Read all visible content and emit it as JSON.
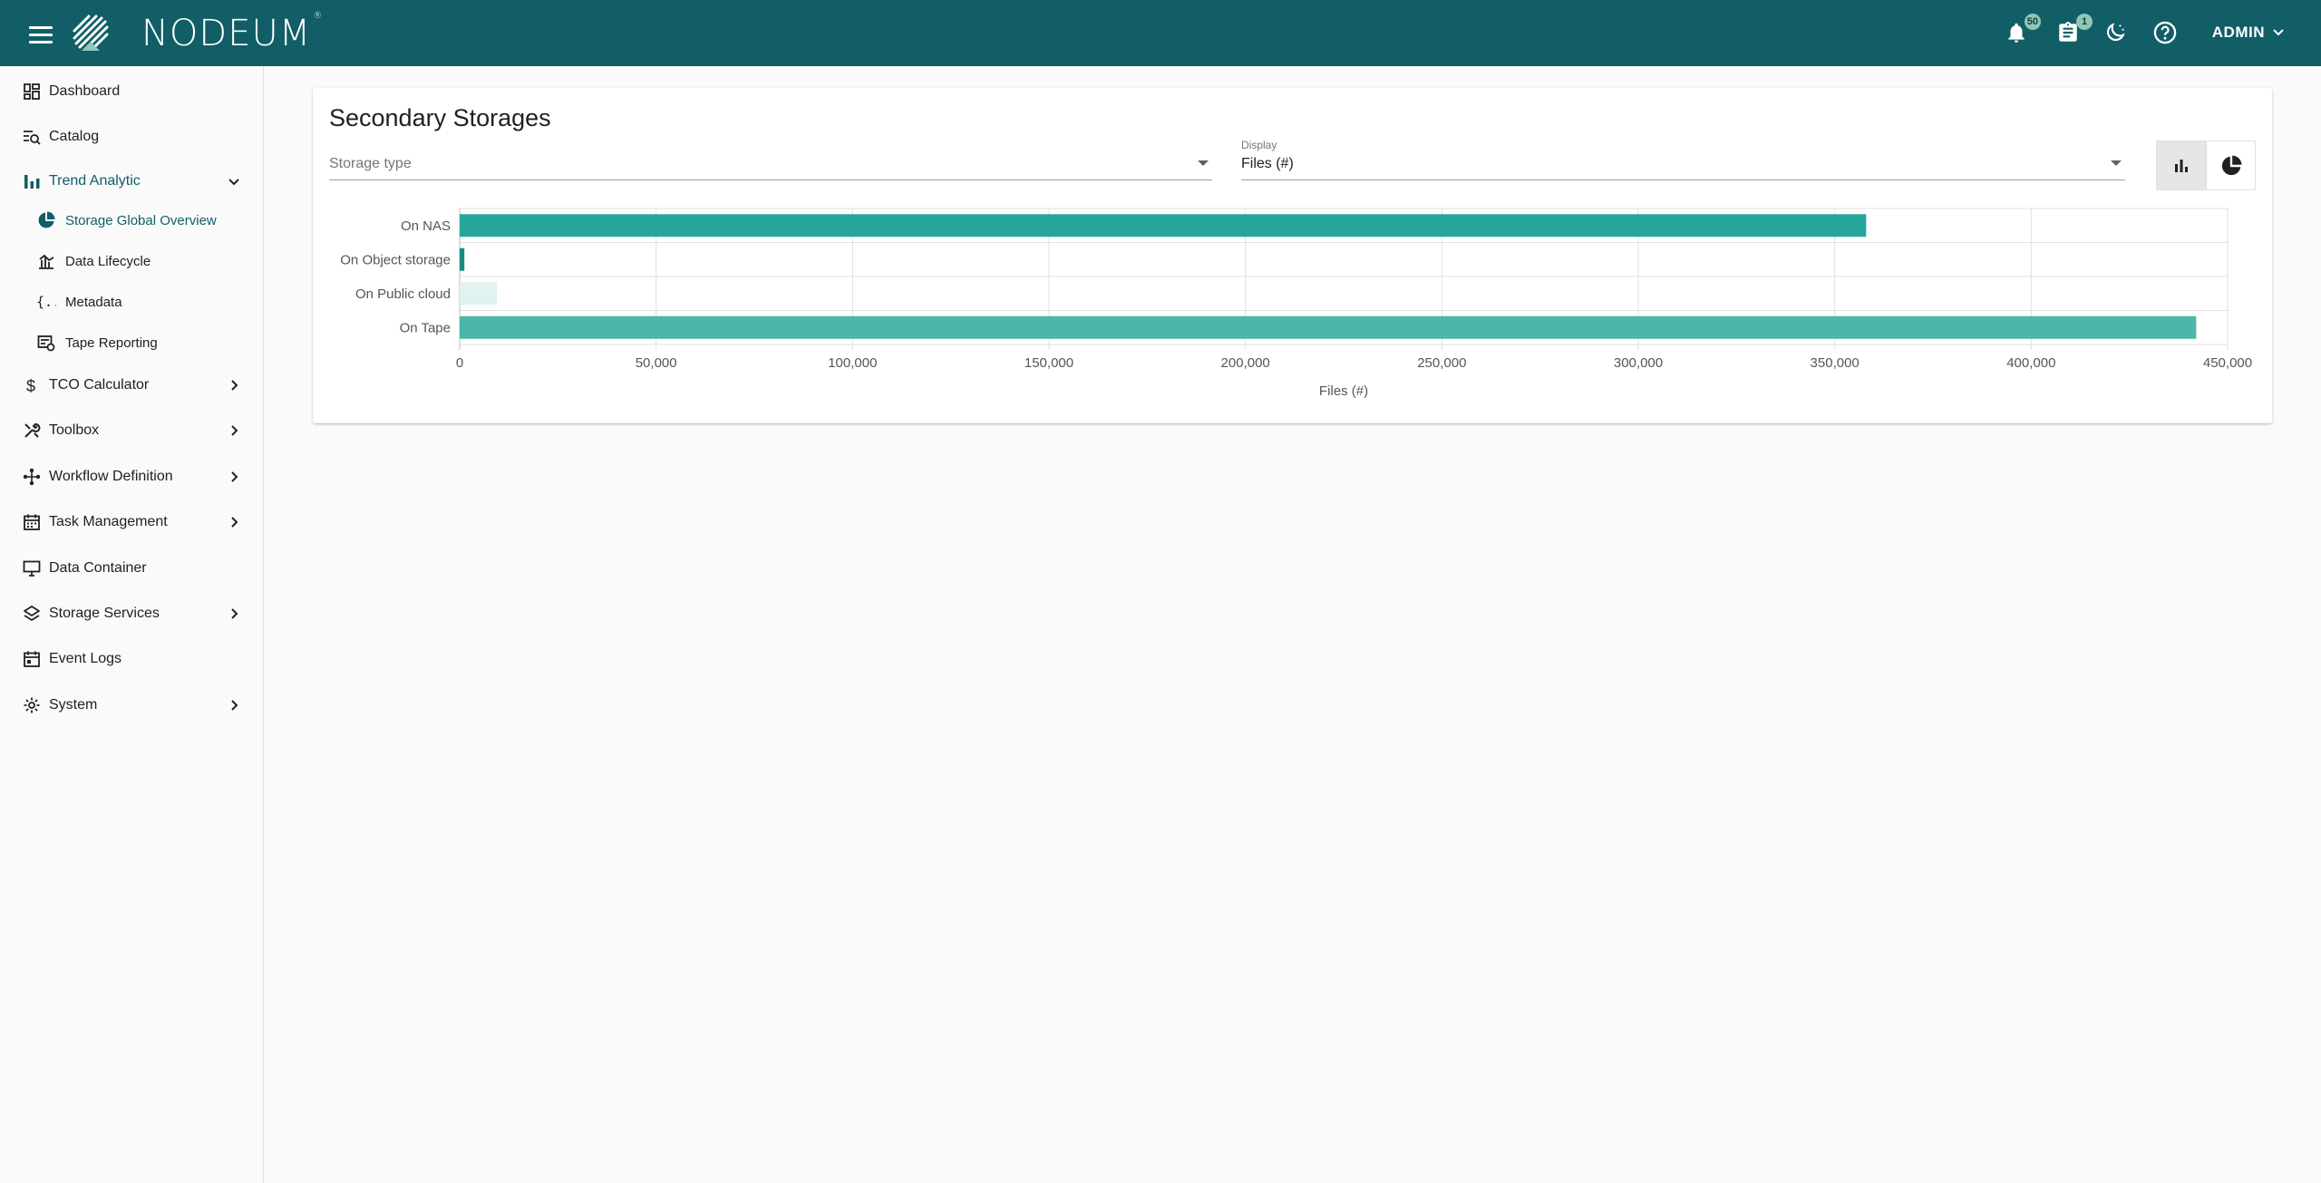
{
  "header": {
    "brand": "NODEUM",
    "brand_mark": "®",
    "notifications_count": "50",
    "tasks_count": "1",
    "user_label": "ADMIN"
  },
  "sidebar": {
    "items": [
      {
        "label": "Dashboard",
        "icon": "dashboard-icon"
      },
      {
        "label": "Catalog",
        "icon": "catalog-search-icon"
      },
      {
        "label": "Trend Analytic",
        "icon": "bar-chart-icon",
        "expanded": true
      },
      {
        "label": "TCO Calculator",
        "icon": "dollar-icon"
      },
      {
        "label": "Toolbox",
        "icon": "tools-icon"
      },
      {
        "label": "Workflow Definition",
        "icon": "workflow-icon"
      },
      {
        "label": "Task Management",
        "icon": "calendar-icon"
      },
      {
        "label": "Data Container",
        "icon": "monitor-icon"
      },
      {
        "label": "Storage Services",
        "icon": "layers-icon"
      },
      {
        "label": "Event Logs",
        "icon": "event-calendar-icon"
      },
      {
        "label": "System",
        "icon": "gear-icon"
      }
    ],
    "trend_sub": [
      {
        "label": "Storage Global Overview",
        "icon": "pie-chart-icon",
        "active": true
      },
      {
        "label": "Data Lifecycle",
        "icon": "lifecycle-chart-icon"
      },
      {
        "label": "Metadata",
        "icon": "braces-icon"
      },
      {
        "label": "Tape Reporting",
        "icon": "tape-report-icon"
      }
    ]
  },
  "card": {
    "title": "Secondary Storages",
    "storage_type_placeholder": "Storage type",
    "display_label": "Display",
    "display_value": "Files (#)"
  },
  "colors": {
    "header": "#115e67",
    "accent": "#26a69a",
    "bar_nas": "#26a69a",
    "bar_object": "#168b7d",
    "bar_cloud": "#e0f2f1",
    "bar_tape": "#4db6ac"
  },
  "chart_data": {
    "type": "bar",
    "orientation": "horizontal",
    "categories": [
      "On NAS",
      "On Object storage",
      "On Public cloud",
      "On Tape"
    ],
    "values": [
      358000,
      1200,
      9500,
      442000
    ],
    "xlabel": "Files (#)",
    "xlim": [
      0,
      450000
    ],
    "xticks": [
      "0",
      "50,000",
      "100,000",
      "150,000",
      "200,000",
      "250,000",
      "300,000",
      "350,000",
      "400,000",
      "450,000"
    ],
    "grid": true
  }
}
